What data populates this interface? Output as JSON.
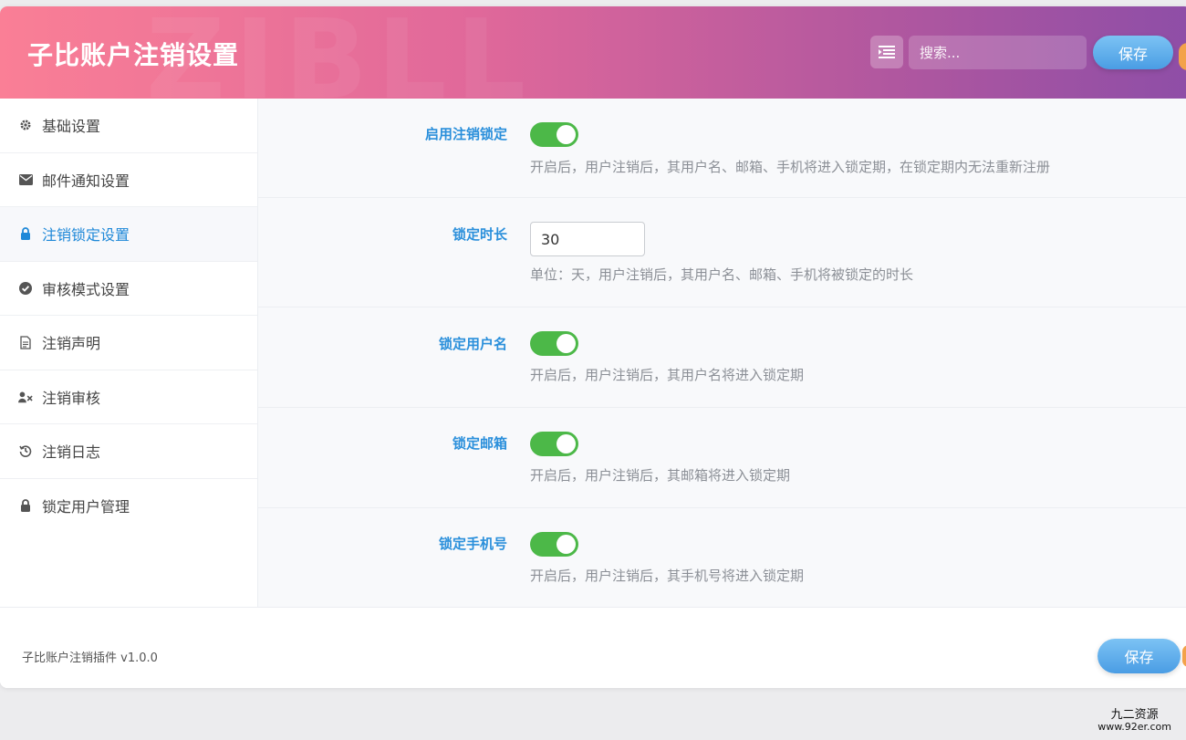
{
  "header": {
    "title": "子比账户注销设置",
    "watermark": "ZIBLL",
    "search_placeholder": "搜索...",
    "save_label": "保存"
  },
  "sidebar": {
    "items": [
      {
        "label": "基础设置",
        "icon": "gear-icon"
      },
      {
        "label": "邮件通知设置",
        "icon": "envelope-icon"
      },
      {
        "label": "注销锁定设置",
        "icon": "lock-icon",
        "active": true
      },
      {
        "label": "审核模式设置",
        "icon": "check-circle-icon"
      },
      {
        "label": "注销声明",
        "icon": "document-icon"
      },
      {
        "label": "注销审核",
        "icon": "user-remove-icon"
      },
      {
        "label": "注销日志",
        "icon": "history-icon"
      },
      {
        "label": "锁定用户管理",
        "icon": "lock-icon"
      }
    ]
  },
  "settings": {
    "enable_lock": {
      "label": "启用注销锁定",
      "enabled": true,
      "desc": "开启后，用户注销后，其用户名、邮箱、手机将进入锁定期，在锁定期内无法重新注册"
    },
    "lock_duration": {
      "label": "锁定时长",
      "value": "30",
      "desc": "单位：天，用户注销后，其用户名、邮箱、手机将被锁定的时长"
    },
    "lock_username": {
      "label": "锁定用户名",
      "enabled": true,
      "desc": "开启后，用户注销后，其用户名将进入锁定期"
    },
    "lock_email": {
      "label": "锁定邮箱",
      "enabled": true,
      "desc": "开启后，用户注销后，其邮箱将进入锁定期"
    },
    "lock_phone": {
      "label": "锁定手机号",
      "enabled": true,
      "desc": "开启后，用户注销后，其手机号将进入锁定期"
    }
  },
  "footer": {
    "plugin_info": "子比账户注销插件 v1.0.0",
    "save_label": "保存"
  },
  "site_watermark": {
    "name": "九二资源",
    "url": "www.92er.com"
  },
  "colors": {
    "header_gradient_start": "#fa7f96",
    "header_gradient_end": "#8e4ea7",
    "accent": "#2a8fdb",
    "toggle_on": "#4cb848",
    "save_button": "#4a9de4"
  }
}
